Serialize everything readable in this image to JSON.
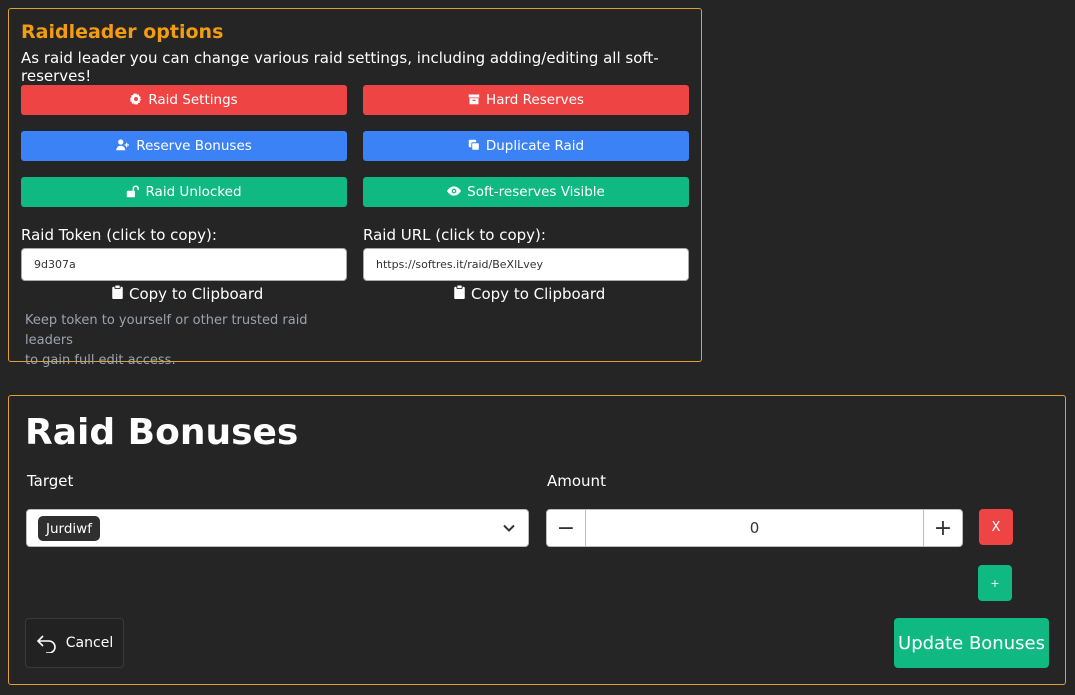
{
  "raidleader": {
    "title": "Raidleader options",
    "description": "As raid leader you can change various raid settings, including adding/editing all soft-reserves!",
    "buttons": {
      "raid_settings": "Raid Settings",
      "hard_reserves": "Hard Reserves",
      "reserve_bonuses": "Reserve Bonuses",
      "duplicate_raid": "Duplicate Raid",
      "raid_unlocked": "Raid Unlocked",
      "softreserves_visible": "Soft-reserves Visible"
    },
    "token": {
      "label": "Raid Token (click to copy):",
      "value": "9d307a",
      "copy_label": "Copy to Clipboard"
    },
    "url": {
      "label": "Raid URL (click to copy):",
      "value": "https://softres.it/raid/BeXlLvey",
      "copy_label": "Copy to Clipboard"
    },
    "hint_line1": "Keep token to yourself or other trusted raid leaders",
    "hint_line2": "to gain full edit access."
  },
  "bonuses": {
    "title": "Raid Bonuses",
    "target_label": "Target",
    "amount_label": "Amount",
    "selected_target": "Jurdiwf",
    "amount_value": "0",
    "minus_label": "−",
    "plus_label": "+",
    "remove_label": "X",
    "add_label": "+",
    "cancel_label": "Cancel",
    "update_label": "Update Bonuses"
  },
  "colors": {
    "accent_orange": "#f39c12",
    "red": "#ef4444",
    "blue": "#3b82f6",
    "green": "#10b981",
    "background": "#252525"
  },
  "icons": [
    "gear-icon",
    "archive-icon",
    "user-plus-icon",
    "copy-icon",
    "unlock-icon",
    "eye-icon",
    "clipboard-icon",
    "chevron-down-icon",
    "undo-icon"
  ]
}
